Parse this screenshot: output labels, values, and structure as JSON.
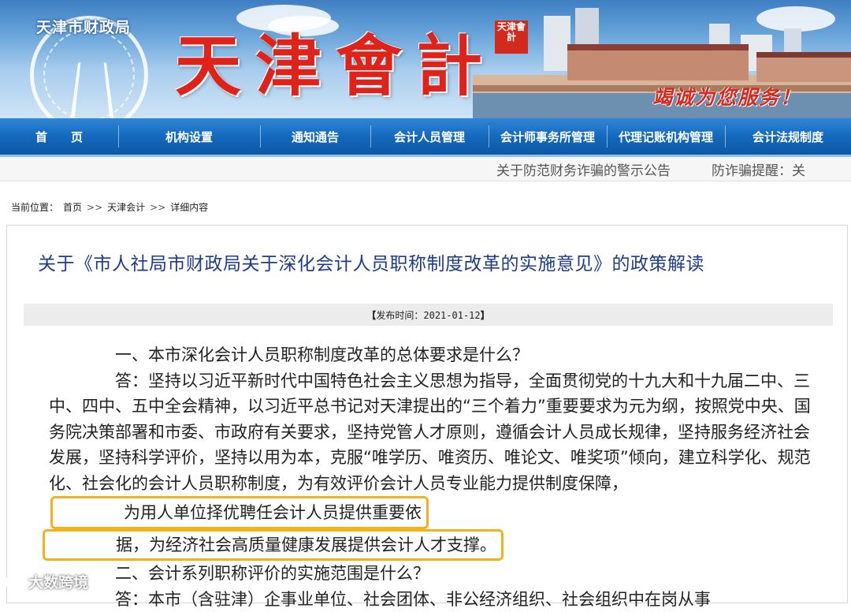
{
  "banner": {
    "bureau": "天津市财政局",
    "title": "天津會計",
    "seal_text": "天津會計",
    "slogan": "竭诚为您服务！"
  },
  "nav": {
    "items": [
      {
        "label": "首　　页"
      },
      {
        "label": "机构设置"
      },
      {
        "label": "通知通告"
      },
      {
        "label": "会计人员管理"
      },
      {
        "label": "会计师事务所管理"
      },
      {
        "label": "代理记账机构管理"
      },
      {
        "label": "会计法规制度"
      }
    ]
  },
  "ticker": {
    "items": [
      "关于防范财务诈骗的警示公告",
      "防诈骗提醒：关"
    ]
  },
  "breadcrumb": {
    "prefix": "当前位置：",
    "items": [
      "首页",
      "天津会计",
      "详细内容"
    ],
    "separator": ">>"
  },
  "article": {
    "title": "关于《市人社局市财政局关于深化会计人员职称制度改革的实施意见》的政策解读",
    "publish_bracket_open": "【",
    "publish_label": "发布时间：2021-01-12",
    "publish_bracket_close": "】",
    "q1": "一、本市深化会计人员职称制度改革的总体要求是什么？",
    "a1_label": "答：",
    "a1_text": "坚持以习近平新时代中国特色社会主义思想为指导，全面贯彻党的十九大和十九届二中、三中、四中、五中全会精神，以习近平总书记对天津提出的“三个着力”重要要求为元为纲，按照党中央、国务院决策部署和市委、市政府有关要求，坚持党管人才原则，遵循会计人员成长规律，坚持服务经济社会发展，坚持科学评价，坚持以用为本，克服“唯学历、唯资历、唯论文、唯奖项”倾向，建立科学化、规范化、社会化的会计人员职称制度，为有效评价会计人员专业能力提供制度保障，",
    "a1_highlight_1": "为用人单位择优聘任会计人员提供重要依",
    "a1_highlight_2": "据，为经济社会高质量健康发展提供会计人才支撑。",
    "q2": "二、会计系列职称评价的实施范围是什么？",
    "a2_label": "答：",
    "a2_text": "本市（含驻津）企事业单位、社会团体、非公经济组织、社会组织中在岗从事"
  },
  "watermark": {
    "text": "大数跨境"
  },
  "colors": {
    "nav_bg": "#1469bd",
    "title_blue": "#1f3c8c",
    "highlight_border": "#f2b21d",
    "logo_red": "#e0231a"
  }
}
